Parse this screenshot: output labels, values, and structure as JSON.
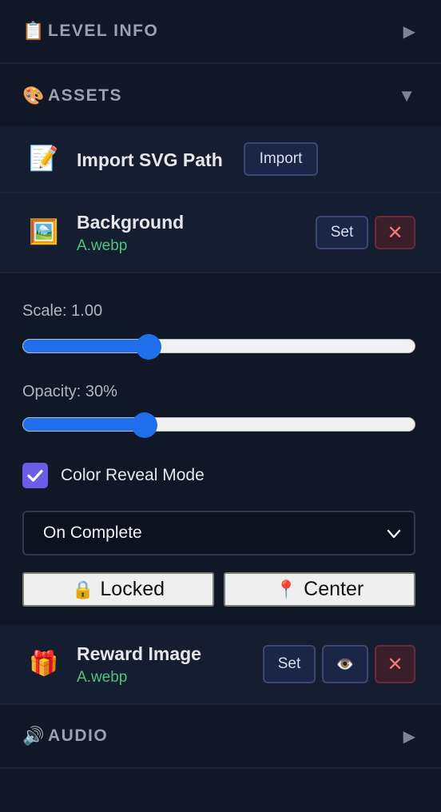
{
  "sections": {
    "level_info": {
      "emoji": "📋",
      "title": "LEVEL INFO",
      "arrow": "▶",
      "icon": "clipboard-icon"
    },
    "assets": {
      "emoji": "🎨",
      "title": "ASSETS",
      "arrow": "▼",
      "icon": "palette-icon"
    },
    "audio": {
      "emoji": "🔊",
      "title": "AUDIO",
      "arrow": "▶",
      "icon": "speaker-icon"
    }
  },
  "assets": {
    "import_svg": {
      "emoji": "📝",
      "label": "Import SVG Path",
      "button": "Import"
    },
    "background": {
      "emoji": "🖼️",
      "label": "Background",
      "file": "A.webp",
      "set_button": "Set",
      "clear_button": "✕"
    },
    "scale": {
      "label": "Scale: 1.00",
      "value": 0.32
    },
    "opacity": {
      "label": "Opacity: 30%",
      "value": 0.31
    },
    "color_reveal": {
      "label": "Color Reveal Mode",
      "checked": true
    },
    "reveal_select": {
      "selected": "On Complete"
    },
    "locked_button": {
      "emoji": "🔒",
      "label": "Locked"
    },
    "center_button": {
      "emoji": "📍",
      "label": "Center"
    },
    "reward": {
      "emoji": "🎁",
      "label": "Reward Image",
      "file": "A.webp",
      "set_button": "Set",
      "eye": "👁️",
      "clear_button": "✕"
    }
  },
  "colors": {
    "background": "#101828",
    "row": "#151e30",
    "accent": "#1f6fec",
    "file_green": "#4ec27f",
    "checkbox": "#6a5de7"
  }
}
